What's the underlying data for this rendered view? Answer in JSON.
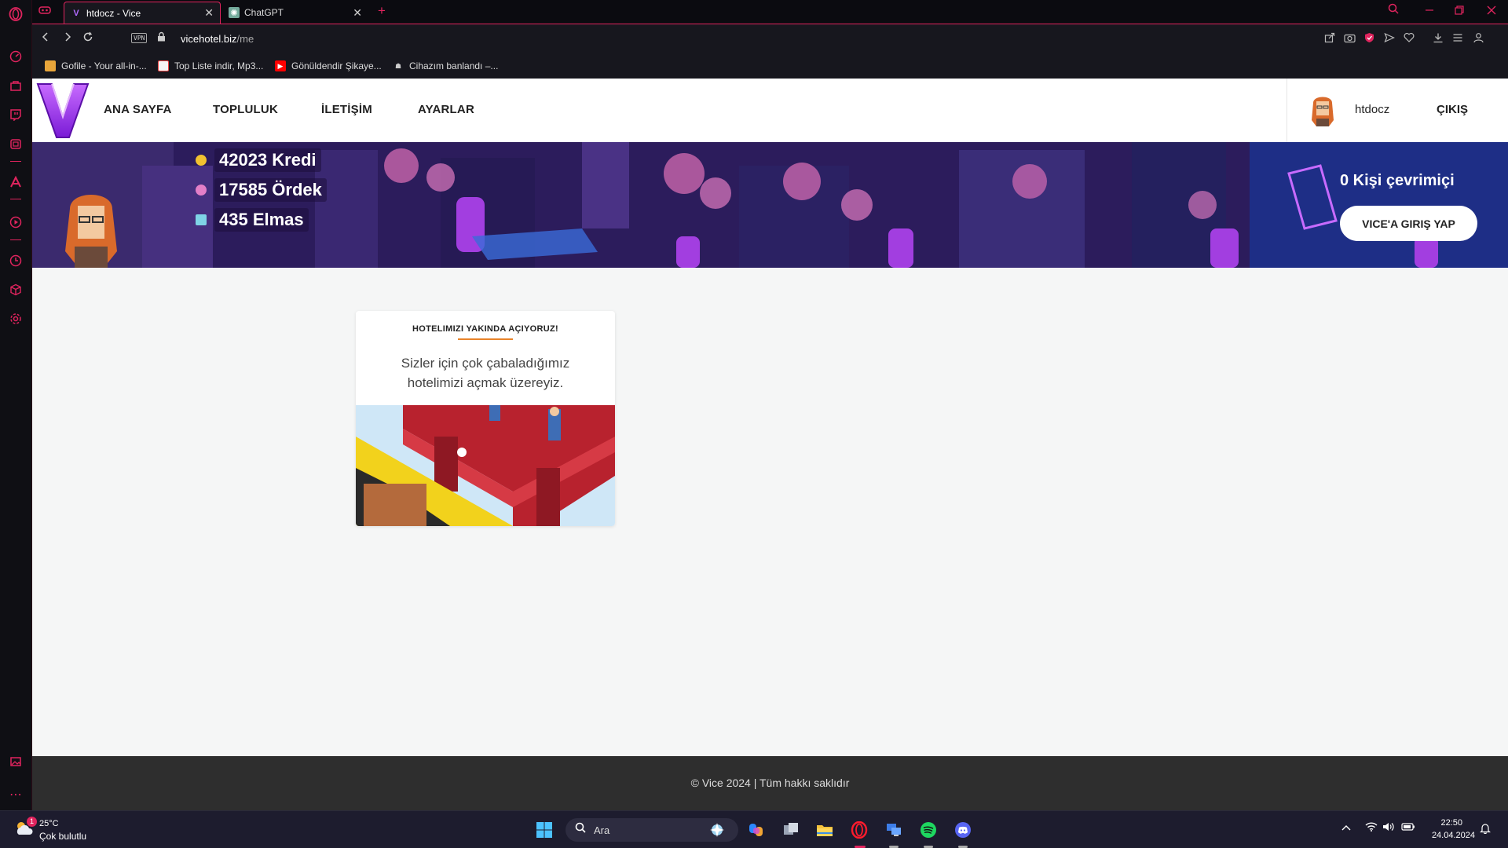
{
  "browser": {
    "tabs": [
      {
        "title": "htdocz - Vice",
        "favicon": "V",
        "active": true
      },
      {
        "title": "ChatGPT",
        "favicon": "gpt-icon",
        "active": false
      }
    ],
    "new_tab": "+",
    "vpn_label": "VPN",
    "url_host": "vicehotel.biz",
    "url_path": "/me",
    "bookmarks": [
      {
        "label": "Gofile - Your all-in-..."
      },
      {
        "label": "Top Liste indir, Mp3..."
      },
      {
        "label": "Gönüldendir Şikaye..."
      },
      {
        "label": "Cihazım banlandı –..."
      }
    ],
    "accent_color": "#e0245e"
  },
  "site": {
    "nav": [
      {
        "label": "ANA SAYFA"
      },
      {
        "label": "TOPLULUK"
      },
      {
        "label": "İLETİŞİM"
      },
      {
        "label": "AYARLAR"
      }
    ],
    "username": "htdocz",
    "logout_label": "ÇIKIŞ",
    "stats": [
      {
        "text": "42023 Kredi",
        "color": "#f2c230"
      },
      {
        "text": "17585 Ördek",
        "color": "#e37fc8"
      },
      {
        "text": "435 Elmas",
        "color": "#7fd3e6"
      }
    ],
    "online_text": "0 Kişi çevrimiçi",
    "enter_button": "VICE'A GIRIŞ YAP",
    "card": {
      "title": "HOTELIMIZI YAKINDA AÇIYORUZ!",
      "text": "Sizler için çok çabaladığımız hotelimizi açmak üzereyiz."
    },
    "footer": "© Vice 2024 | Tüm hakkı saklıdır"
  },
  "taskbar": {
    "weather_badge": "1",
    "weather_temp": "25°C",
    "weather_desc": "Çok bulutlu",
    "search_placeholder": "Ara",
    "time": "22:50",
    "date": "24.04.2024"
  }
}
